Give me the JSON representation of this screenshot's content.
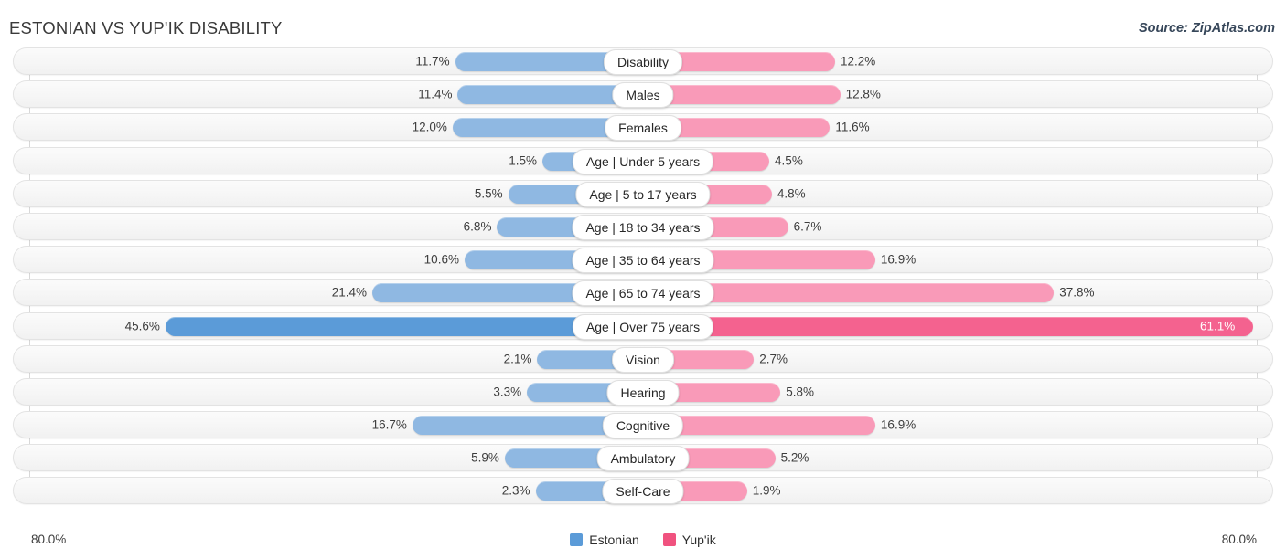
{
  "header": {
    "title": "ESTONIAN VS YUP'IK DISABILITY",
    "source": "Source: ZipAtlas.com"
  },
  "axis": {
    "left_label": "80.0%",
    "right_label": "80.0%",
    "max": 80.0
  },
  "legend": {
    "items": [
      {
        "label": "Estonian",
        "color": "#5b9bd8"
      },
      {
        "label": "Yup'ik",
        "color": "#f0527f"
      }
    ]
  },
  "chart_data": {
    "type": "bar",
    "title": "ESTONIAN VS YUP'IK DISABILITY",
    "orientation": "horizontal-diverging",
    "xlabel": "",
    "ylabel": "",
    "xlim": [
      80.0,
      80.0
    ],
    "grid": true,
    "legend_position": "bottom-center",
    "categories": [
      "Disability",
      "Males",
      "Females",
      "Age | Under 5 years",
      "Age | 5 to 17 years",
      "Age | 18 to 34 years",
      "Age | 35 to 64 years",
      "Age | 65 to 74 years",
      "Age | Over 75 years",
      "Vision",
      "Hearing",
      "Cognitive",
      "Ambulatory",
      "Self-Care"
    ],
    "series": [
      {
        "name": "Estonian",
        "color": "#8fb8e2",
        "values": [
          11.7,
          11.4,
          12.0,
          1.5,
          5.5,
          6.8,
          10.6,
          21.4,
          45.6,
          2.1,
          3.3,
          16.7,
          5.9,
          2.3
        ],
        "labels": [
          "11.7%",
          "11.4%",
          "12.0%",
          "1.5%",
          "5.5%",
          "6.8%",
          "10.6%",
          "21.4%",
          "45.6%",
          "2.1%",
          "3.3%",
          "16.7%",
          "5.9%",
          "2.3%"
        ]
      },
      {
        "name": "Yup'ik",
        "color": "#f99ab8",
        "values": [
          12.2,
          12.8,
          11.6,
          4.5,
          4.8,
          6.7,
          16.9,
          37.8,
          61.1,
          2.7,
          5.8,
          16.9,
          5.2,
          1.9
        ],
        "labels": [
          "12.2%",
          "12.8%",
          "11.6%",
          "4.5%",
          "4.8%",
          "6.7%",
          "16.9%",
          "37.8%",
          "61.1%",
          "2.7%",
          "5.8%",
          "16.9%",
          "5.2%",
          "1.9%"
        ]
      }
    ],
    "highlighted_row": "Age | Over 75 years"
  }
}
